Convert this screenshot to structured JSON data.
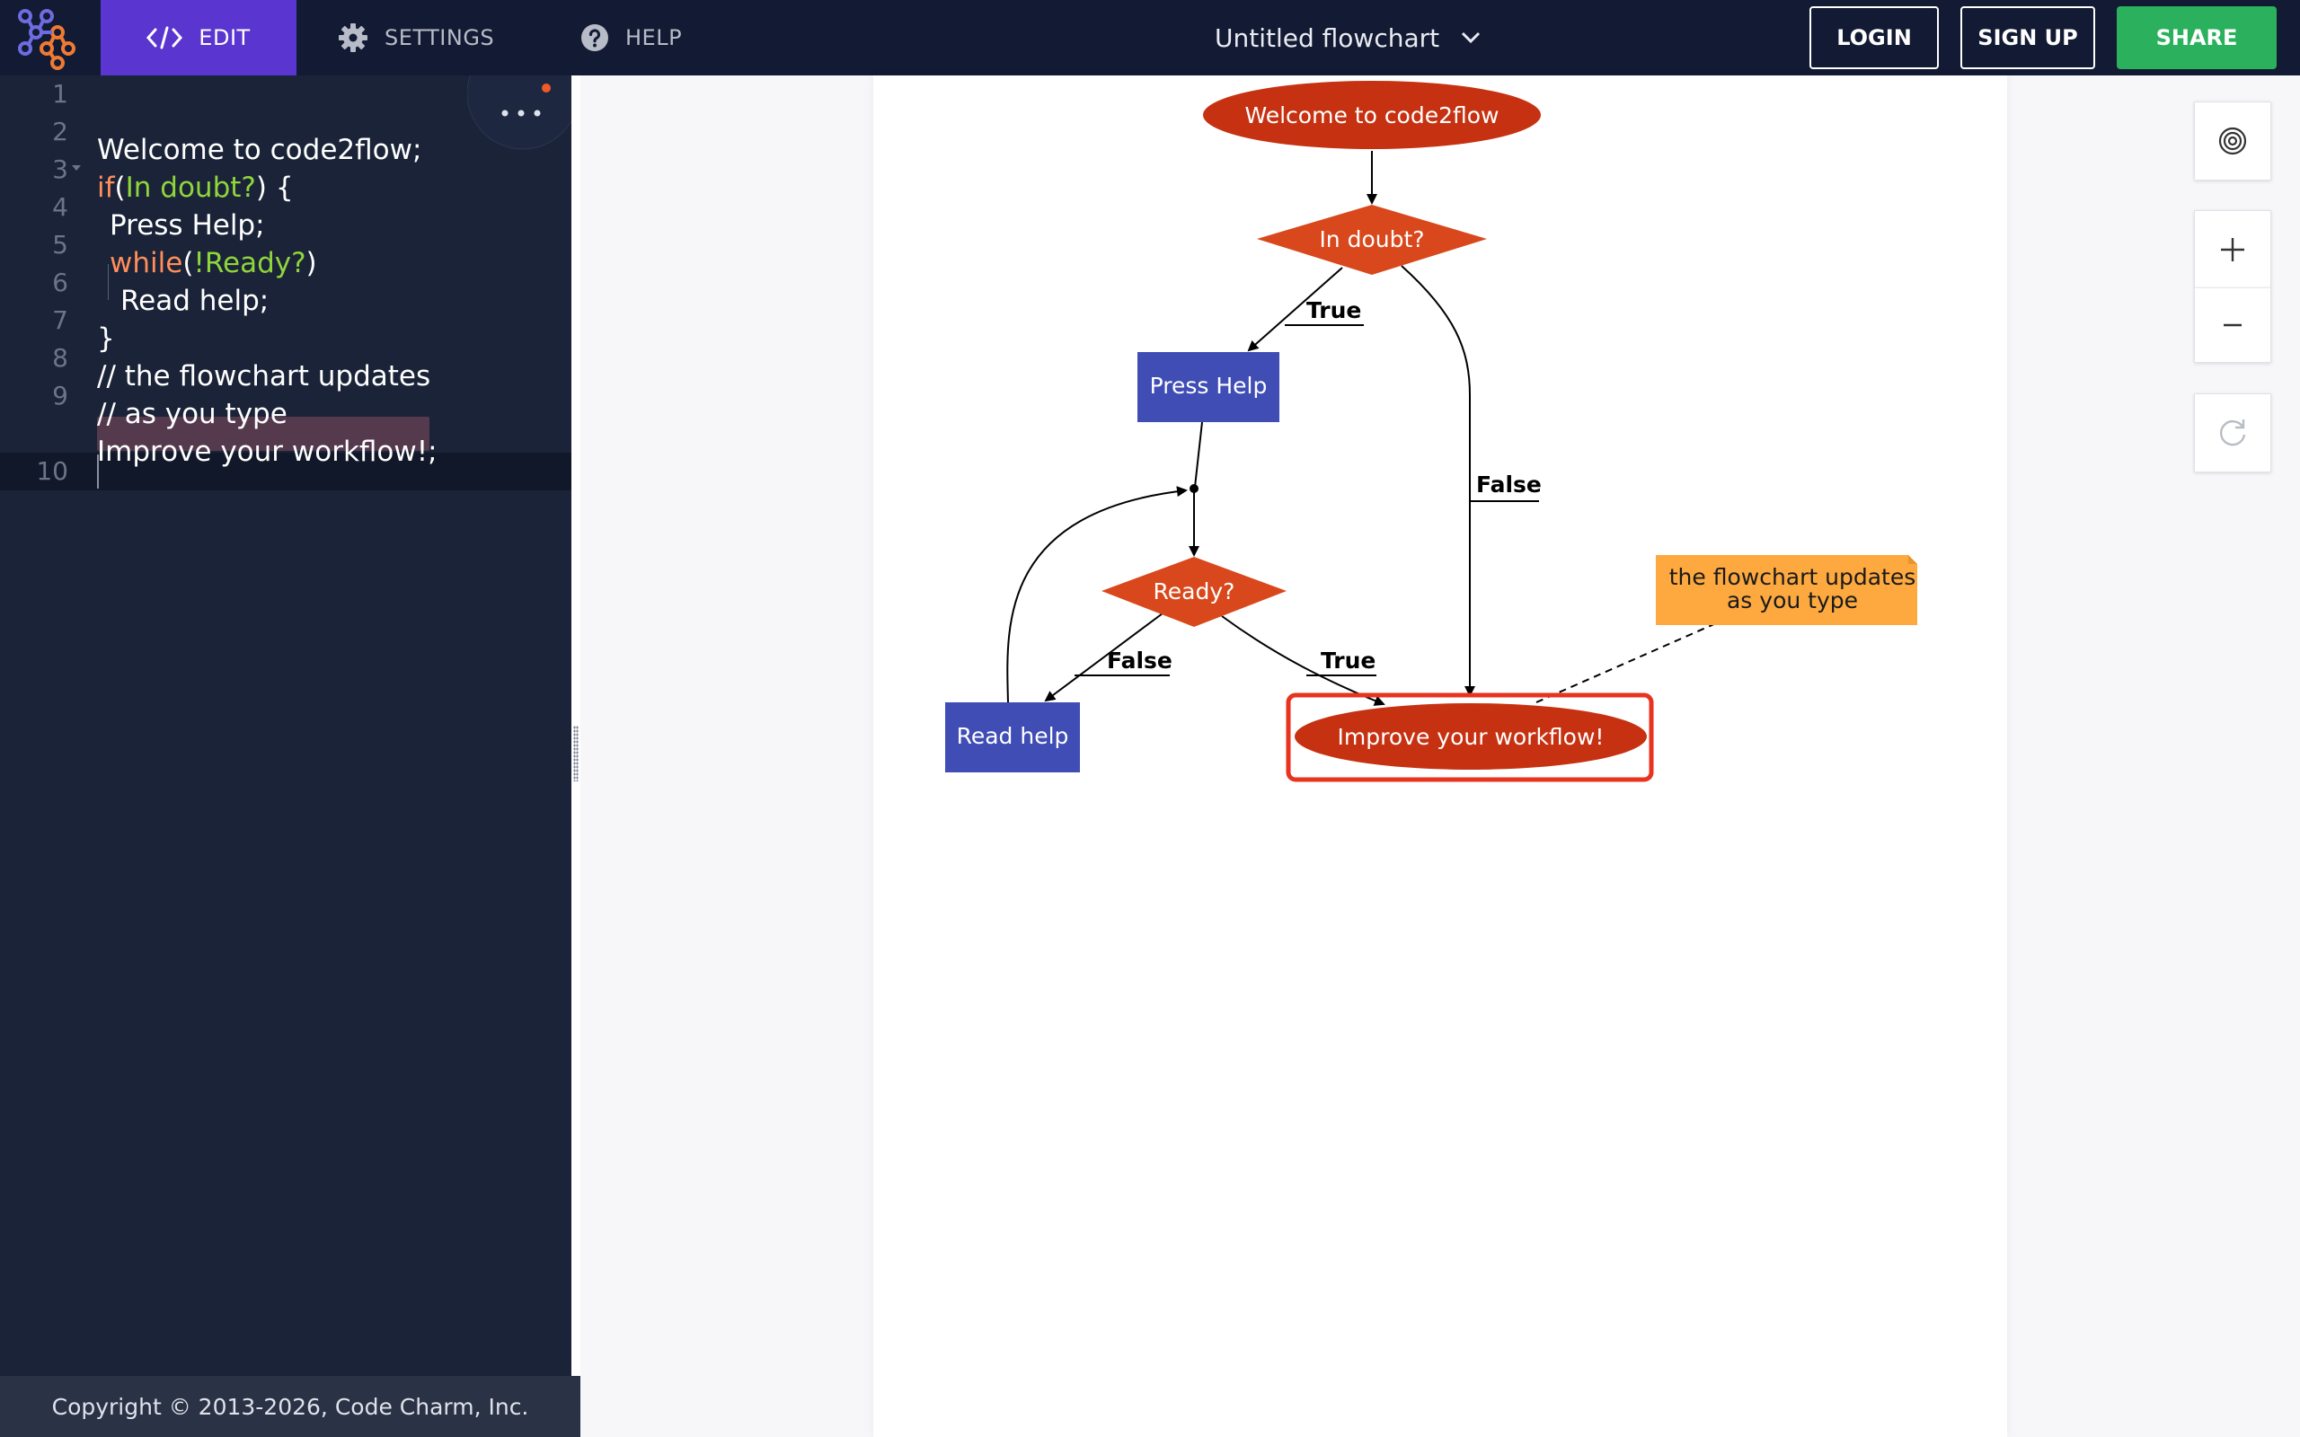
{
  "nav": {
    "edit_label": "EDIT",
    "settings_label": "SETTINGS",
    "help_label": "HELP",
    "document_title": "Untitled flowchart",
    "login_label": "LOGIN",
    "signup_label": "SIGN UP",
    "share_label": "SHARE"
  },
  "editor": {
    "line_numbers": [
      "1",
      "2",
      "3",
      "4",
      "5",
      "6",
      "7",
      "8",
      "9",
      "10"
    ],
    "lines": {
      "l1": "Welcome to code2flow;",
      "l2_kw": "if",
      "l2_open": "(",
      "l2_cond": "In doubt?",
      "l2_close": ") {",
      "l3": "Press Help;",
      "l4_kw": "while",
      "l4_open": "(",
      "l4_cond": "!Ready?",
      "l4_close": ")",
      "l5": "Read help;",
      "l6": "}",
      "l7": "// the flowchart updates",
      "l8": "// as you type",
      "l9": "Improve your workflow!;"
    },
    "footer": "Copyright © 2013-2026, Code Charm, Inc."
  },
  "flowchart": {
    "start": "Welcome to code2flow",
    "decision1": "In doubt?",
    "process1": "Press Help",
    "decision2": "Ready?",
    "process2": "Read help",
    "end": "Improve your workflow!",
    "note_line1": "the flowchart updates",
    "note_line2": "as you type",
    "edge_true_1": "True",
    "edge_false_1": "False",
    "edge_false_2": "False",
    "edge_true_2": "True"
  },
  "colors": {
    "topbar": "#121b33",
    "edit_tab": "#5a35cf",
    "share": "#2bb15d",
    "terminal": "#c63211",
    "decision": "#d9481c",
    "process": "#3f4db5",
    "note": "#fda940",
    "selection": "#e8331f"
  },
  "icons": {
    "logo": "code2flow-logo",
    "edit": "code-brackets-icon",
    "settings": "gear-icon",
    "help": "question-circle-icon",
    "title_menu": "chevron-down-icon",
    "more": "more-dots-icon",
    "focus": "target-icon",
    "zoom_in": "plus-icon",
    "zoom_out": "minus-icon",
    "reset": "refresh-icon"
  }
}
